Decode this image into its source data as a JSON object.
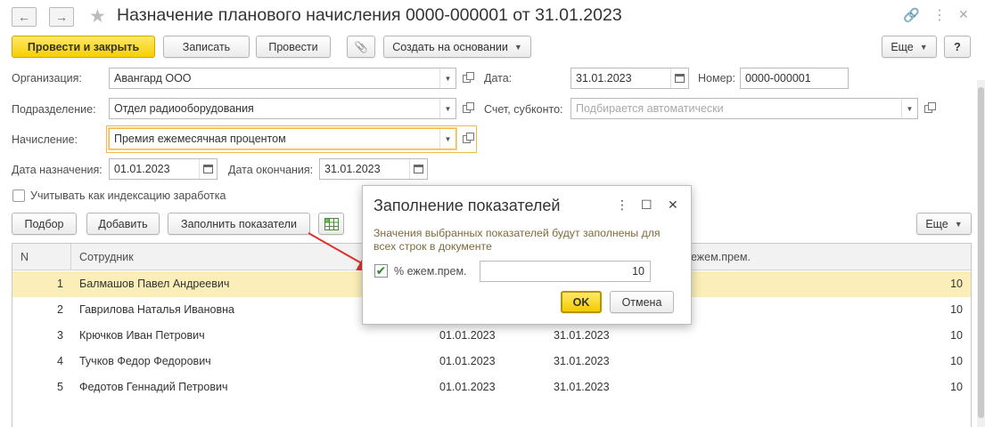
{
  "window": {
    "title": "Назначение планового начисления 0000-000001 от 31.01.2023",
    "back_icon": "←",
    "forward_icon": "→",
    "star_icon": "★",
    "link_icon": "🔗",
    "menu_icon": "⋮",
    "maximize_icon": "☐",
    "close_icon": "✕"
  },
  "toolbar": {
    "post_close": "Провести и закрыть",
    "save": "Записать",
    "post": "Провести",
    "attach_icon": "📎",
    "create_based": "Создать на основании",
    "more": "Еще",
    "help": "?"
  },
  "form": {
    "org_label": "Организация:",
    "org_value": "Авангард ООО",
    "date_label": "Дата:",
    "date_value": "31.01.2023",
    "number_label": "Номер:",
    "number_value": "0000-000001",
    "dept_label": "Подразделение:",
    "dept_value": "Отдел радиооборудования",
    "account_label": "Счет, субконто:",
    "account_placeholder": "Подбирается автоматически",
    "accrual_label": "Начисление:",
    "accrual_value": "Премия ежемесячная процентом",
    "assign_date_label": "Дата назначения:",
    "assign_date_value": "01.01.2023",
    "end_date_label": "Дата окончания:",
    "end_date_value": "31.01.2023",
    "indexation_label": "Учитывать как индексацию заработка"
  },
  "table_toolbar": {
    "select": "Подбор",
    "add": "Добавить",
    "fill": "Заполнить показатели",
    "more": "Еще"
  },
  "table": {
    "headers": {
      "n": "N",
      "employee": "Сотрудник",
      "indicator": "ежем.прем."
    },
    "rows": [
      {
        "n": "1",
        "employee": "Балмашов Павел Андреевич",
        "start": "",
        "end": "",
        "value": "10"
      },
      {
        "n": "2",
        "employee": "Гаврилова Наталья Ивановна",
        "start": "",
        "end": "",
        "value": "10"
      },
      {
        "n": "3",
        "employee": "Крючков Иван Петрович",
        "start": "01.01.2023",
        "end": "31.01.2023",
        "value": "10"
      },
      {
        "n": "4",
        "employee": "Тучков Федор Федорович",
        "start": "01.01.2023",
        "end": "31.01.2023",
        "value": "10"
      },
      {
        "n": "5",
        "employee": "Федотов Геннадий Петрович",
        "start": "01.01.2023",
        "end": "31.01.2023",
        "value": "10"
      }
    ]
  },
  "dialog": {
    "title": "Заполнение показателей",
    "note": "Значения выбранных показателей будут заполнены для всех строк в документе",
    "check_label": "% ежем.прем.",
    "check_mark": "✔",
    "value": "10",
    "ok": "OK",
    "cancel": "Отмена"
  },
  "colors": {
    "accent": "#f5d000",
    "selected_row": "#fbeeb8",
    "arrow": "#d9342b"
  }
}
